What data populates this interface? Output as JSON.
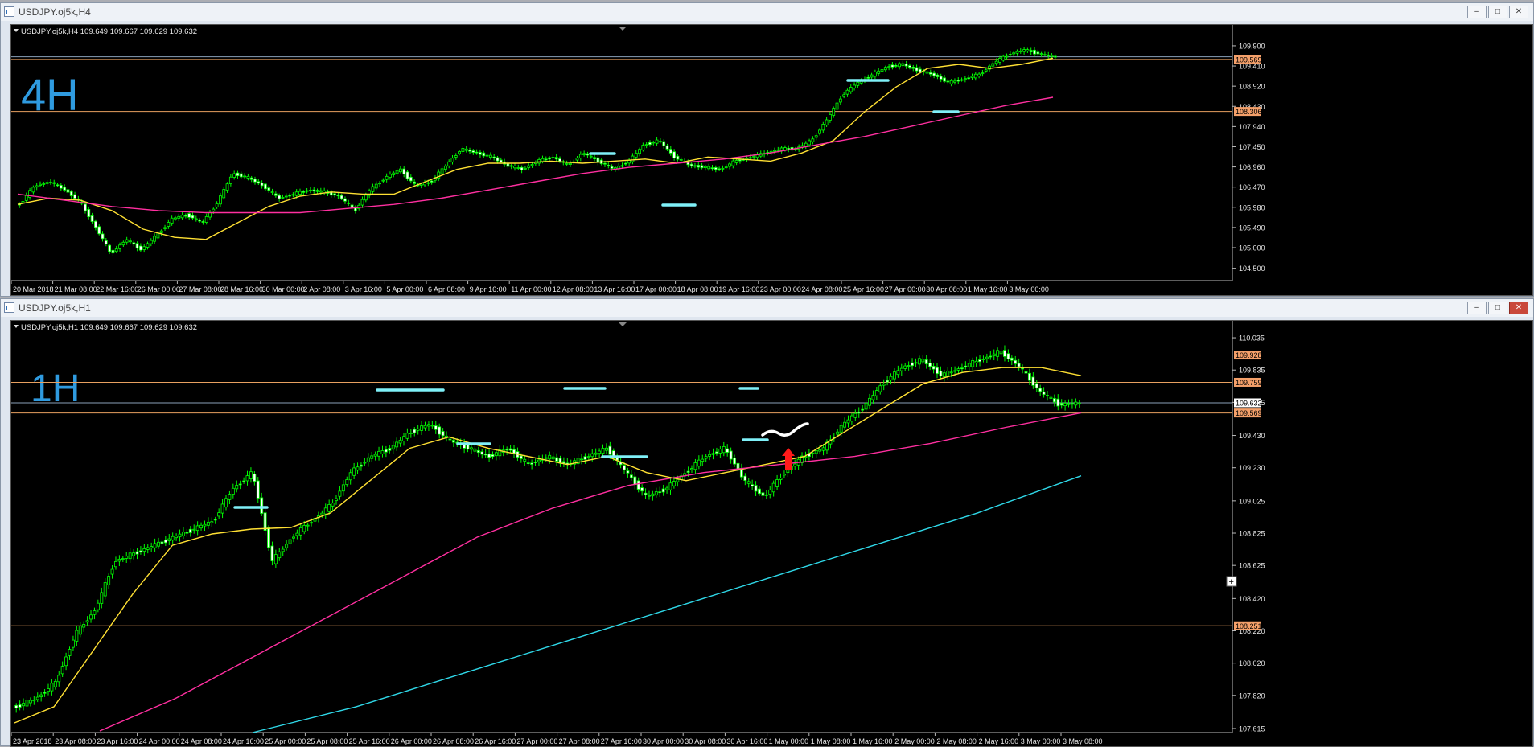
{
  "windows": [
    {
      "title": "USDJPY.oj5k,H4"
    },
    {
      "title": "USDJPY.oj5k,H1"
    }
  ],
  "window_controls": {
    "minimize": "–",
    "maximize": "□",
    "close": "✕"
  },
  "chart_data": [
    {
      "type": "candlestick",
      "header": "USDJPY.oj5k,H4  109.649 109.667 109.629 109.632",
      "annotation": "4H",
      "ylim": [
        104.2,
        110.25
      ],
      "y_ticks": [
        "109.900",
        "109.410",
        "108.920",
        "108.430",
        "107.940",
        "107.450",
        "106.960",
        "106.470",
        "105.980",
        "105.490",
        "105.000",
        "104.500"
      ],
      "y_tick_values": [
        109.9,
        109.41,
        108.92,
        108.43,
        107.94,
        107.45,
        106.96,
        106.47,
        105.98,
        105.49,
        105.0,
        104.5
      ],
      "x_ticks": [
        "20 Mar 2018",
        "21 Mar 08:00",
        "22 Mar 16:00",
        "26 Mar 00:00",
        "27 Mar 08:00",
        "28 Mar 16:00",
        "30 Mar 00:00",
        "2 Apr 08:00",
        "3 Apr 16:00",
        "5 Apr 00:00",
        "6 Apr 08:00",
        "9 Apr 16:00",
        "11 Apr 00:00",
        "12 Apr 08:00",
        "13 Apr 16:00",
        "17 Apr 00:00",
        "18 Apr 08:00",
        "19 Apr 16:00",
        "23 Apr 00:00",
        "24 Apr 08:00",
        "25 Apr 16:00",
        "27 Apr 00:00",
        "30 Apr 08:00",
        "1 May 16:00",
        "3 May 00:00"
      ],
      "hlines": [
        {
          "value": 109.569,
          "label": "109.569",
          "color": "#e8a060"
        },
        {
          "value": 108.306,
          "label": "108.306",
          "color": "#e8a060"
        },
        {
          "value": 109.632,
          "color": "#8aa0b8"
        }
      ],
      "series": [
        {
          "kind": "price",
          "color": "#00ff00",
          "values": [
            106.05,
            106.5,
            106.6,
            106.4,
            106.1,
            105.5,
            104.85,
            105.2,
            104.95,
            105.3,
            105.7,
            105.8,
            105.6,
            106.1,
            106.8,
            106.7,
            106.5,
            106.2,
            106.3,
            106.4,
            106.35,
            106.25,
            105.9,
            106.4,
            106.7,
            106.9,
            106.5,
            106.6,
            107.0,
            107.4,
            107.3,
            107.2,
            107.0,
            106.9,
            107.1,
            107.2,
            107.0,
            107.3,
            107.1,
            106.9,
            107.1,
            107.5,
            107.6,
            107.2,
            107.0,
            106.95,
            106.9,
            107.1,
            107.2,
            107.3,
            107.4,
            107.4,
            107.6,
            108.1,
            108.7,
            109.0,
            109.2,
            109.4,
            109.45,
            109.3,
            109.2,
            109.0,
            109.1,
            109.2,
            109.5,
            109.7,
            109.8,
            109.7,
            109.63
          ]
        },
        {
          "kind": "ma",
          "color": "#ffe033",
          "values": [
            106.05,
            106.2,
            106.15,
            105.9,
            105.45,
            105.25,
            105.2,
            105.6,
            106.0,
            106.25,
            106.35,
            106.3,
            106.3,
            106.6,
            106.9,
            107.05,
            107.05,
            107.1,
            107.05,
            107.1,
            107.15,
            107.05,
            107.2,
            107.15,
            107.1,
            107.3,
            107.6,
            108.3,
            108.9,
            109.35,
            109.45,
            109.35,
            109.45,
            109.6
          ]
        },
        {
          "kind": "ma",
          "color": "#ff2fa0",
          "values": [
            106.3,
            106.15,
            106.0,
            105.9,
            105.85,
            105.85,
            105.85,
            105.95,
            106.05,
            106.2,
            106.4,
            106.6,
            106.8,
            106.95,
            107.05,
            107.15,
            107.3,
            107.5,
            107.7,
            107.95,
            108.2,
            108.45,
            108.65
          ]
        }
      ]
    },
    {
      "type": "candlestick",
      "header": "USDJPY.oj5k,H1  109.649 109.667 109.629 109.632",
      "annotation": "1H",
      "ylim": [
        107.59,
        110.1
      ],
      "y_ticks": [
        "110.035",
        "109.835",
        "109.635",
        "109.430",
        "109.230",
        "109.025",
        "108.825",
        "108.625",
        "108.420",
        "108.220",
        "108.020",
        "107.820",
        "107.615"
      ],
      "y_tick_values": [
        110.035,
        109.835,
        109.635,
        109.43,
        109.23,
        109.025,
        108.825,
        108.625,
        108.42,
        108.22,
        108.02,
        107.82,
        107.615
      ],
      "x_ticks": [
        "23 Apr 2018",
        "23 Apr 08:00",
        "23 Apr 16:00",
        "24 Apr 00:00",
        "24 Apr 08:00",
        "24 Apr 16:00",
        "25 Apr 00:00",
        "25 Apr 08:00",
        "25 Apr 16:00",
        "26 Apr 00:00",
        "26 Apr 08:00",
        "26 Apr 16:00",
        "27 Apr 00:00",
        "27 Apr 08:00",
        "27 Apr 16:00",
        "30 Apr 00:00",
        "30 Apr 08:00",
        "30 Apr 16:00",
        "1 May 00:00",
        "1 May 08:00",
        "1 May 16:00",
        "2 May 00:00",
        "2 May 08:00",
        "2 May 16:00",
        "3 May 00:00",
        "3 May 08:00"
      ],
      "hlines": [
        {
          "value": 109.928,
          "label": "109.928",
          "color": "#e8a060"
        },
        {
          "value": 109.759,
          "label": "109.759",
          "color": "#e8a060"
        },
        {
          "value": 109.569,
          "label": "109.569",
          "color": "#e8a060"
        },
        {
          "value": 108.251,
          "label": "108.251",
          "color": "#e8a060"
        },
        {
          "value": 109.632,
          "label": "109.632",
          "color": "#8aa0b8"
        }
      ],
      "series": [
        {
          "kind": "price",
          "color": "#00ff00",
          "values": [
            107.75,
            107.8,
            107.9,
            108.2,
            108.35,
            108.65,
            108.7,
            108.75,
            108.8,
            108.85,
            108.9,
            109.1,
            109.2,
            108.65,
            108.8,
            108.9,
            109.0,
            109.2,
            109.3,
            109.35,
            109.45,
            109.5,
            109.4,
            109.35,
            109.3,
            109.35,
            109.25,
            109.3,
            109.25,
            109.3,
            109.35,
            109.2,
            109.05,
            109.1,
            109.2,
            109.3,
            109.35,
            109.15,
            109.05,
            109.2,
            109.3,
            109.35,
            109.5,
            109.6,
            109.75,
            109.85,
            109.9,
            109.8,
            109.85,
            109.9,
            109.95,
            109.85,
            109.7,
            109.62,
            109.63
          ]
        },
        {
          "kind": "ma",
          "color": "#ffe033",
          "values": [
            107.65,
            107.75,
            108.1,
            108.45,
            108.75,
            108.82,
            108.85,
            108.86,
            108.95,
            109.15,
            109.35,
            109.42,
            109.35,
            109.3,
            109.25,
            109.3,
            109.2,
            109.15,
            109.2,
            109.25,
            109.3,
            109.45,
            109.6,
            109.75,
            109.82,
            109.85,
            109.85,
            109.8
          ]
        },
        {
          "kind": "ma",
          "color": "#ff2fa0",
          "values": [
            107.6,
            107.8,
            108.05,
            108.3,
            108.55,
            108.8,
            108.98,
            109.12,
            109.2,
            109.25,
            109.3,
            109.38,
            109.48,
            109.57
          ]
        },
        {
          "kind": "ma",
          "color": "#2fd8e8",
          "values": [
            107.59,
            107.75,
            107.95,
            108.15,
            108.35,
            108.55,
            108.75,
            108.95,
            109.18
          ]
        }
      ]
    }
  ]
}
